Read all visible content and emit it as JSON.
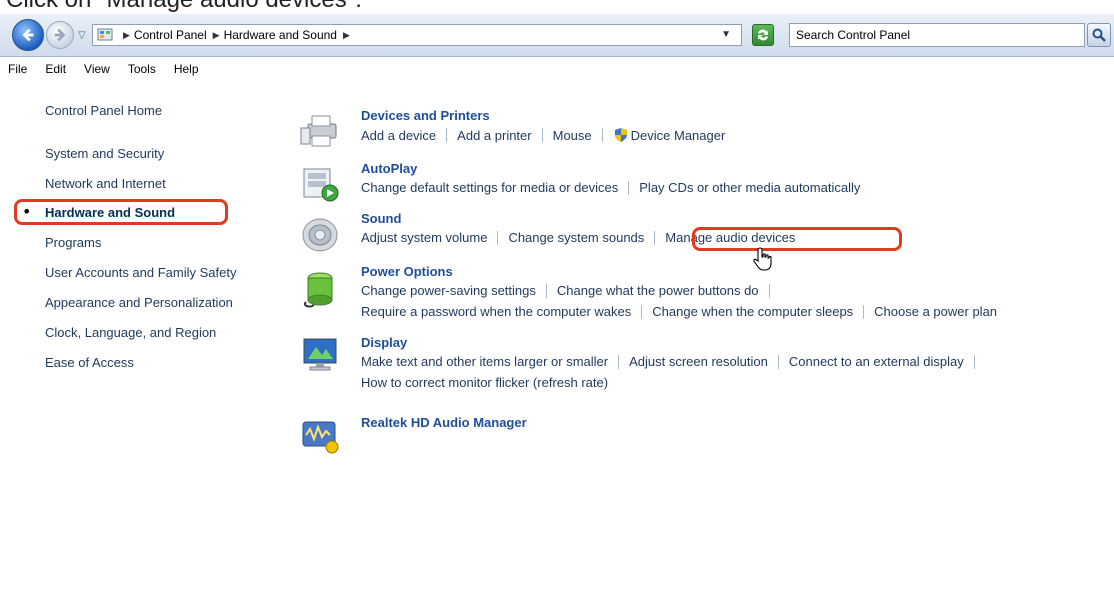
{
  "instruction": "Click on \"Manage audio devices\".",
  "address_bar": {
    "crumbs": [
      "Control Panel",
      "Hardware and Sound"
    ],
    "search_placeholder": "Search Control Panel"
  },
  "menu": [
    "File",
    "Edit",
    "View",
    "Tools",
    "Help"
  ],
  "left_nav": {
    "items": [
      "Control Panel Home",
      "System and Security",
      "Network and Internet",
      "Hardware and Sound",
      "Programs",
      "User Accounts and Family Safety",
      "Appearance and Personalization",
      "Clock, Language, and Region",
      "Ease of Access"
    ],
    "current_index": 3
  },
  "categories": [
    {
      "title": "Devices and Printers",
      "icon": "printer-icon",
      "rows": [
        [
          "Add a device",
          "Add a printer",
          "Mouse",
          "Device Manager"
        ]
      ]
    },
    {
      "title": "AutoPlay",
      "icon": "autoplay-icon",
      "rows": [
        [
          "Change default settings for media or devices",
          "Play CDs or other media automatically"
        ]
      ]
    },
    {
      "title": "Sound",
      "icon": "speaker-icon",
      "rows": [
        [
          "Adjust system volume",
          "Change system sounds",
          "Manage audio devices"
        ]
      ]
    },
    {
      "title": "Power Options",
      "icon": "battery-icon",
      "rows": [
        [
          "Change power-saving settings",
          "Change what the power buttons do"
        ],
        [
          "Require a password when the computer wakes",
          "Change when the computer sleeps",
          "Choose a power plan"
        ]
      ]
    },
    {
      "title": "Display",
      "icon": "monitor-icon",
      "rows": [
        [
          "Make text and other items larger or smaller",
          "Adjust screen resolution",
          "Connect to an external display"
        ],
        [
          "How to correct monitor flicker (refresh rate)"
        ]
      ]
    },
    {
      "title": "Realtek HD Audio Manager",
      "icon": "realtek-icon",
      "rows": []
    }
  ],
  "colors": {
    "highlight": "#e03b1f",
    "link": "#1e395b",
    "heading": "#1e4e9a"
  }
}
